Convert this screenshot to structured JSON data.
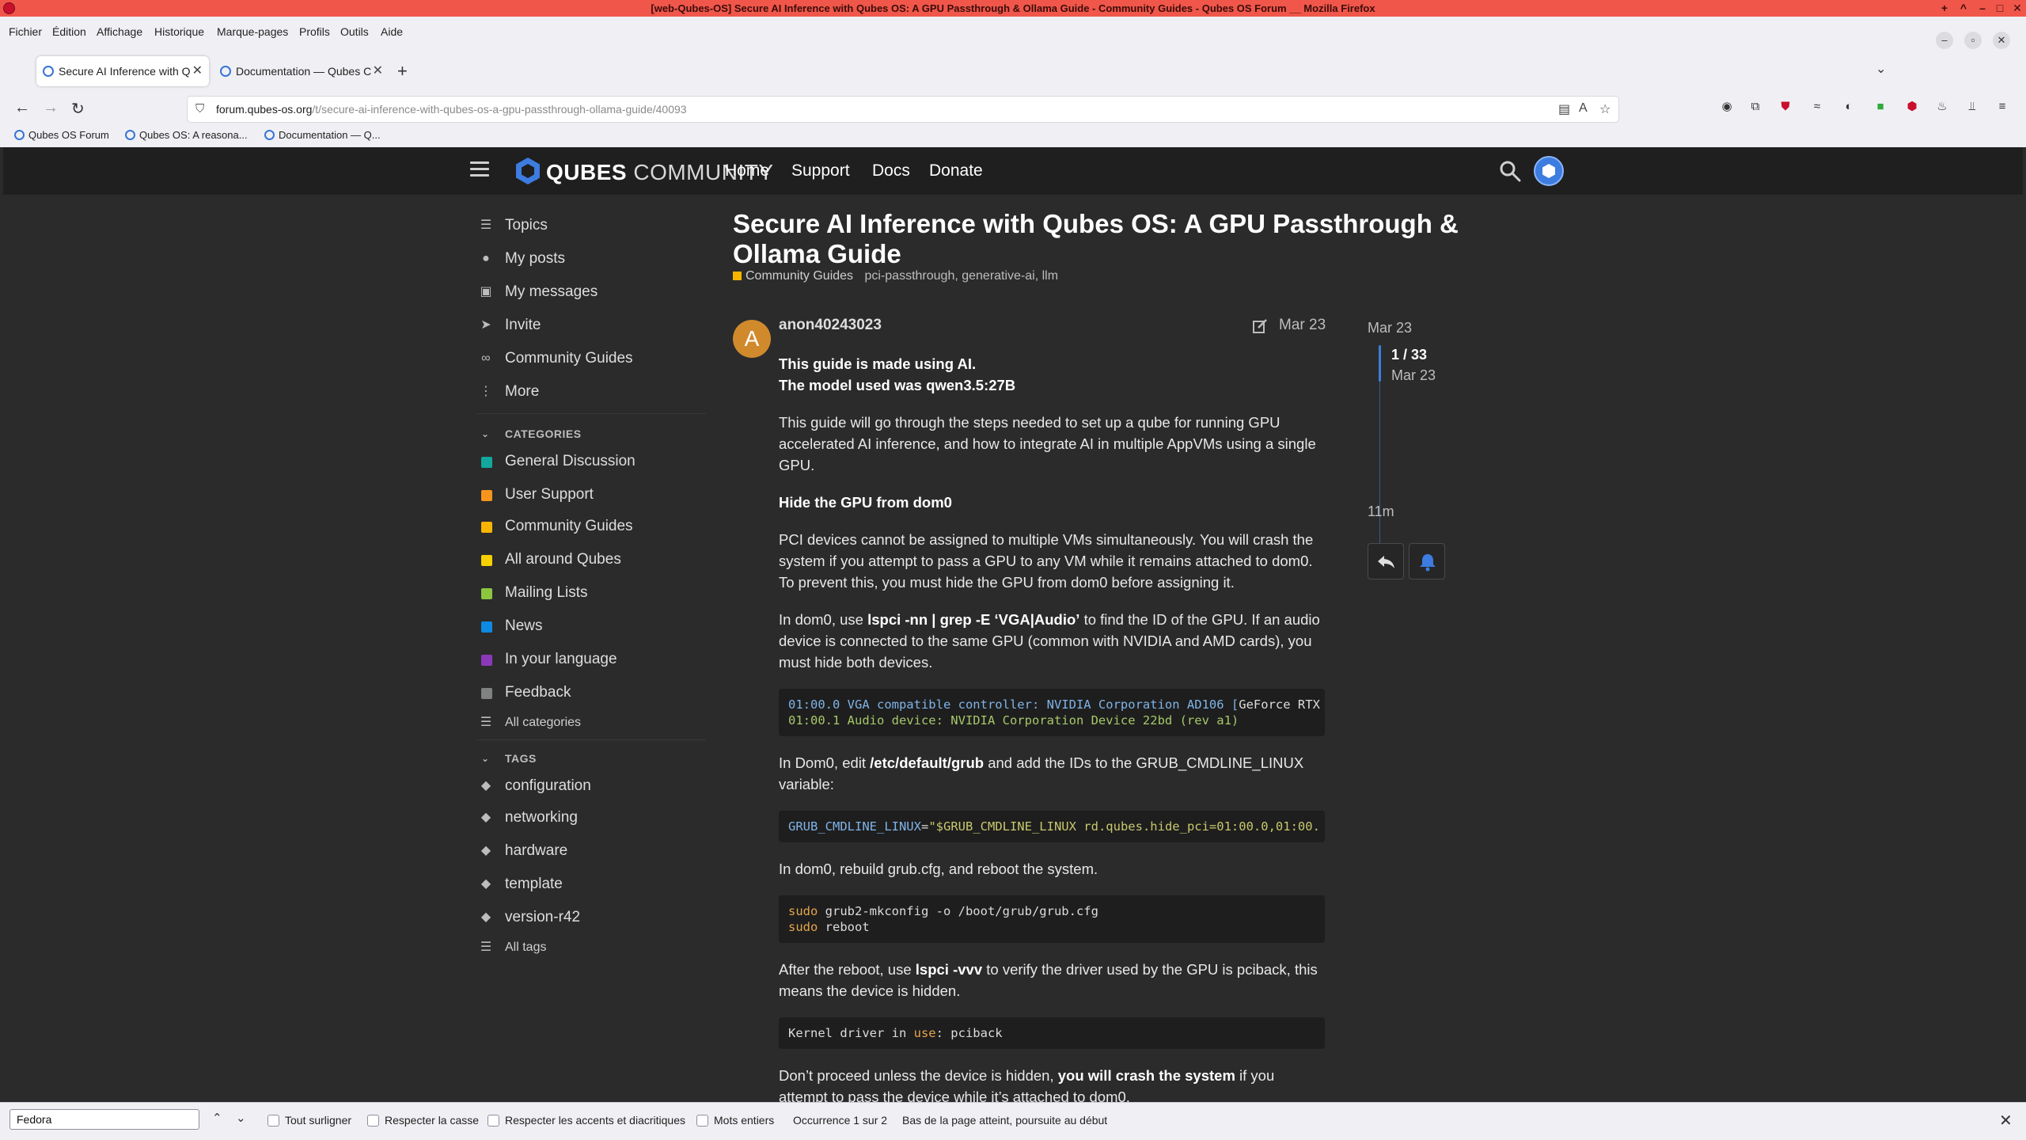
{
  "window": {
    "title": "[web-Qubes-OS] Secure AI Inference with Qubes OS: A GPU Passthrough & Ollama Guide - Community Guides - Qubes OS Forum __ Mozilla Firefox"
  },
  "menubar": {
    "items": [
      "Fichier",
      "Édition",
      "Affichage",
      "Historique",
      "Marque-pages",
      "Profils",
      "Outils",
      "Aide"
    ]
  },
  "tabs": [
    {
      "label": "Secure AI Inference with Q"
    },
    {
      "label": "Documentation — Qubes C"
    }
  ],
  "address_bar": {
    "domain": "forum.qubes-os.org",
    "path": "/t/secure-ai-inference-with-qubes-os-a-gpu-passthrough-ollama-guide/40093"
  },
  "bookmarks": [
    {
      "label": "Qubes OS Forum"
    },
    {
      "label": "Qubes OS: A reasona..."
    },
    {
      "label": "Documentation — Q..."
    }
  ],
  "site_header": {
    "logo_bold": "QUBES",
    "logo_light": " COMMUNITY",
    "nav": [
      "Home",
      "Support",
      "Docs",
      "Donate"
    ]
  },
  "sidebar": {
    "main_items": [
      "Topics",
      "My posts",
      "My messages",
      "Invite",
      "Community Guides",
      "More"
    ],
    "categories_heading": "CATEGORIES",
    "categories": [
      {
        "name": "General Discussion",
        "color": "#12a89d"
      },
      {
        "name": "User Support",
        "color": "#f7941d"
      },
      {
        "name": "Community Guides",
        "color": "#f7b500"
      },
      {
        "name": "All around Qubes",
        "color": "#f7d000"
      },
      {
        "name": "Mailing Lists",
        "color": "#8cc63f"
      },
      {
        "name": "News",
        "color": "#0e8ae2"
      },
      {
        "name": "In your language",
        "color": "#8a3ab9"
      },
      {
        "name": "Feedback",
        "color": "#808281"
      }
    ],
    "all_categories": "All categories",
    "tags_heading": "TAGS",
    "tags": [
      "configuration",
      "networking",
      "hardware",
      "template",
      "version-r42"
    ],
    "all_tags": "All tags"
  },
  "topic": {
    "title": "Secure AI Inference with Qubes OS: A GPU Passthrough & Ollama Guide",
    "category": "Community Guides",
    "tags": "pci-passthrough, generative-ai, llm"
  },
  "post": {
    "avatar_letter": "A",
    "username": "anon40243023",
    "date": "Mar 23",
    "p1_line1": "This guide is made using AI.",
    "p1_line2": "The model used was qwen3.5:27B",
    "p2": "This guide will go through the steps needed to set up a qube for running GPU accelerated AI inference, and how to integrate AI in multiple AppVMs using a single GPU.",
    "h1": "Hide the GPU from dom0",
    "p3": "PCI devices cannot be assigned to multiple VMs simultaneously. You will crash the system if you attempt to pass a GPU to any VM while it remains attached to dom0. To prevent this, you must hide the GPU from dom0 before assigning it.",
    "p4_a": "In dom0, use ",
    "p4_cmd": "lspci -nn | grep -E ‘VGA|Audio’",
    "p4_b": " to find the ID of the GPU. If an audio device is connected to the same GPU (common with NVIDIA and AMD cards), you must hide both devices.",
    "code1_l1_a": "01:00.0 VGA compatible controller: NVIDIA Corporation AD106 [",
    "code1_l1_b": "GeForce RTX",
    "code1_l2": "01:00.1 Audio device: NVIDIA Corporation Device 22bd (rev a1)",
    "p5_a": "In Dom0, edit ",
    "p5_file": "/etc/default/grub",
    "p5_b": " and add the IDs to the GRUB_CMDLINE_LINUX variable:",
    "code2_var": "GRUB_CMDLINE_LINUX",
    "code2_eq": "=",
    "code2_str": "\"$GRUB_CMDLINE_LINUX rd.qubes.hide_pci=01:00.0,01:00.",
    "p6": "In dom0, rebuild grub.cfg, and reboot the system.",
    "code3_l1_kw": "sudo",
    "code3_l1_rest": " grub2-mkconfig -o /boot/grub/grub.cfg",
    "code3_l2_kw": "sudo",
    "code3_l2_rest": " reboot",
    "p7_a": "After the reboot, use ",
    "p7_cmd": "lspci -vvv",
    "p7_b": " to verify the driver used by the GPU is pciback, this means the device is hidden.",
    "code4_a": "Kernel driver in ",
    "code4_kw": "use",
    "code4_b": ": pciback",
    "p8_a": "Don’t proceed unless the device is hidden, ",
    "p8_bold": "you will crash the system",
    "p8_b": " if you attempt to pass the device while it’s attached to dom0."
  },
  "timeline": {
    "start_date": "Mar 23",
    "position": "1 / 33",
    "position_date": "Mar 23",
    "end_label": "11m"
  },
  "findbar": {
    "query": "Fedora",
    "highlight_all": "Tout surligner",
    "match_case": "Respecter la casse",
    "match_diacritics": "Respecter les accents et diacritiques",
    "whole_words": "Mots entiers",
    "occurrence": "Occurrence 1 sur 2",
    "status": "Bas de la page atteint, poursuite au début"
  },
  "colors": {
    "accent": "#3d7ce0",
    "titlebar": "#f0564a",
    "page_bg": "#2b2b2b",
    "header_bg": "#1f1f1f"
  }
}
